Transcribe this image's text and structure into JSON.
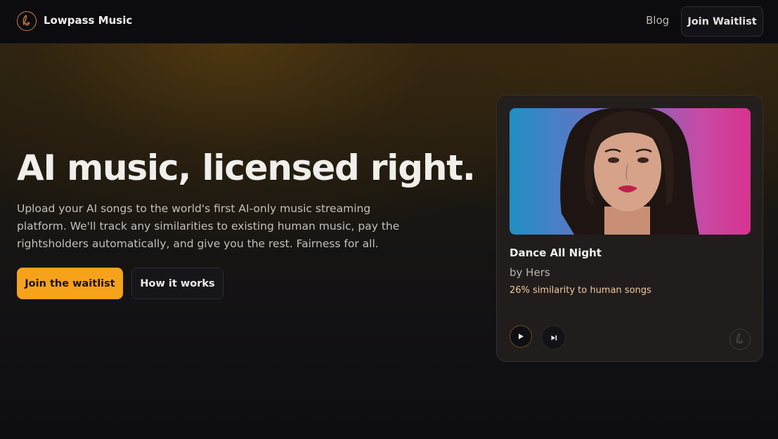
{
  "header": {
    "brand": "Lowpass Music",
    "nav": {
      "blog": "Blog",
      "join": "Join Waitlist"
    },
    "icons": {
      "logo": "lowpass-logo-icon"
    },
    "accent": "#c8833a"
  },
  "hero": {
    "headline": "AI music, licensed right.",
    "subtext": "Upload your AI songs to the world's first AI-only music streaming platform. We'll track any similarities to existing human music, pay the rightsholders automatically, and give you the rest. Fairness for all.",
    "cta_primary": "Join the waitlist",
    "cta_secondary": "How it works",
    "primary_color": "#f7a21b"
  },
  "player_card": {
    "title": "Dance All Night",
    "artist": "by Hers",
    "similarity": "26% similarity to human songs",
    "icons": {
      "play": "play-icon",
      "next": "skip-next-icon",
      "watermark": "lowpass-logo-icon"
    },
    "similarity_color": "#f3c99a"
  }
}
